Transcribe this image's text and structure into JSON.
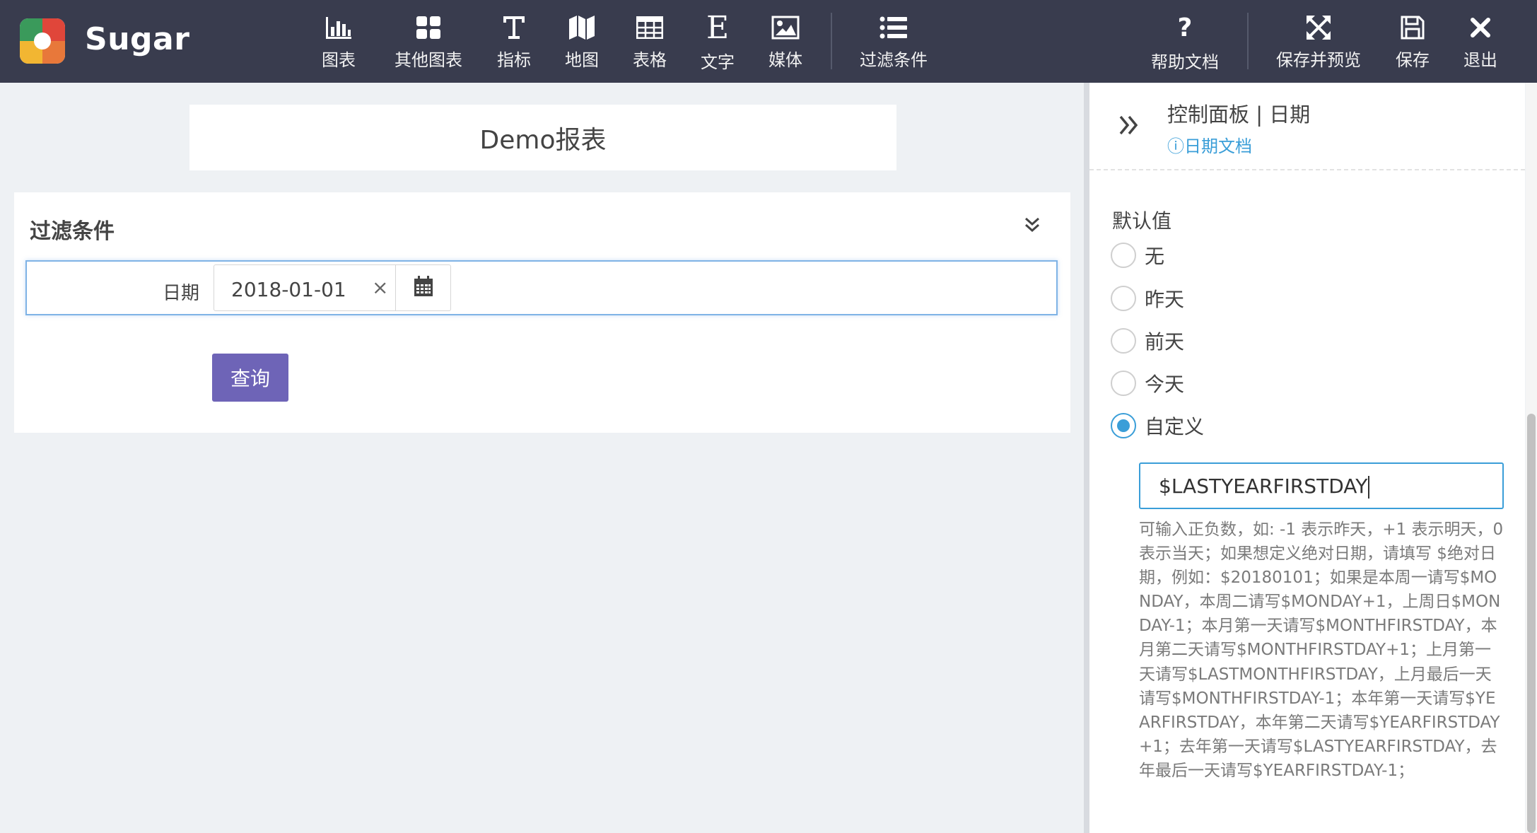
{
  "app": {
    "brand": "Sugar"
  },
  "toolbar": {
    "items": [
      {
        "label": "图表",
        "icon": "bar-chart-icon"
      },
      {
        "label": "其他图表",
        "icon": "grid-icon"
      },
      {
        "label": "指标",
        "icon": "text-metric-icon"
      },
      {
        "label": "地图",
        "icon": "map-icon"
      },
      {
        "label": "表格",
        "icon": "table-icon"
      },
      {
        "label": "文字",
        "icon": "letter-e-icon"
      },
      {
        "label": "媒体",
        "icon": "image-icon"
      },
      {
        "label": "过滤条件",
        "icon": "list-icon"
      }
    ],
    "right": [
      {
        "label": "帮助文档",
        "icon": "question-icon"
      },
      {
        "label": "保存并预览",
        "icon": "expand-arrows-icon"
      },
      {
        "label": "保存",
        "icon": "floppy-disk-icon"
      },
      {
        "label": "退出",
        "icon": "close-icon"
      }
    ]
  },
  "report": {
    "title": "Demo报表"
  },
  "filter": {
    "title": "过滤条件",
    "date_label": "日期",
    "date_value": "2018-01-01",
    "clear_symbol": "×",
    "query_button": "查询"
  },
  "control_panel": {
    "title": "控制面板 | 日期",
    "doc_link": "ⓘ日期文档",
    "default_label": "默认值",
    "options": [
      "无",
      "昨天",
      "前天",
      "今天",
      "自定义"
    ],
    "selected_option": "自定义",
    "custom_value": "$LASTYEARFIRSTDAY",
    "help_text": "可输入正负数，如: -1 表示昨天，+1 表示明天，0表示当天；如果想定义绝对日期，请填写 $绝对日期，例如：$20180101；如果是本周一请写$MONDAY，本周二请写$MONDAY+1，上周日$MONDAY-1；本月第一天请写$MONTHFIRSTDAY，本月第二天请写$MONTHFIRSTDAY+1；上月第一天请写$LASTMONTHFIRSTDAY，上月最后一天请写$MONTHFIRSTDAY-1；本年第一天请写$YEARFIRSTDAY，本年第二天请写$YEARFIRSTDAY+1；去年第一天请写$LASTYEARFIRSTDAY，去年最后一天请写$YEARFIRSTDAY-1；"
  },
  "colors": {
    "topbar": "#393c4e",
    "accent_blue": "#3a9ed8",
    "query_purple": "#6e64b7",
    "canvas_bg": "#eef1f4"
  }
}
